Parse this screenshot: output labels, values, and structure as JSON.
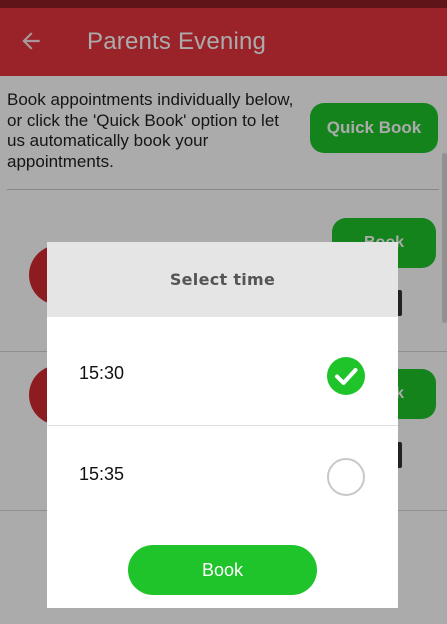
{
  "app_bar": {
    "title": "Parents Evening",
    "back_icon": "arrow-left-icon",
    "color": "#e5353c"
  },
  "intro": {
    "text": "Book appointments individually below, or click the 'Quick Book' option to let us automatically book your appointments."
  },
  "quick_book": {
    "label": "Quick Book"
  },
  "rows": [
    {
      "book_label": "Book"
    },
    {
      "book_label": "Book"
    }
  ],
  "dialog": {
    "title": "Select time",
    "options": [
      {
        "time": "15:30",
        "selected": true
      },
      {
        "time": "15:35",
        "selected": false
      }
    ],
    "book_label": "Book"
  },
  "colors": {
    "accent_green": "#1fc42a",
    "brand_red": "#e5353c"
  }
}
